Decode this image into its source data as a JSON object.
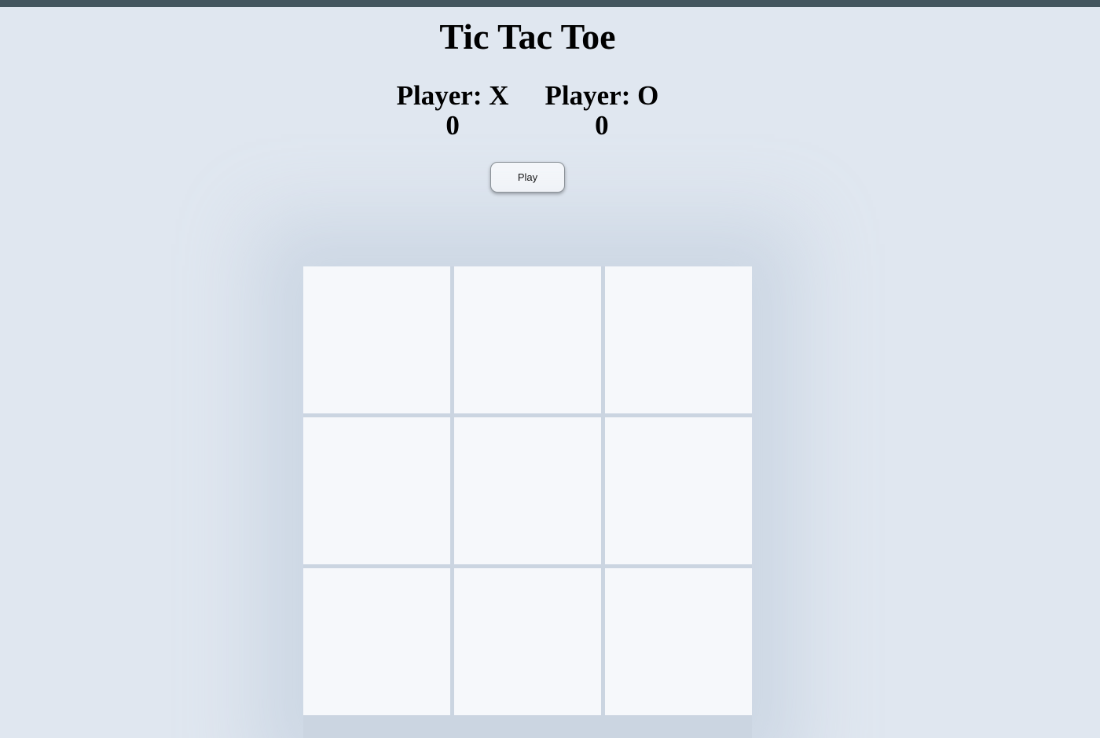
{
  "title": "Tic Tac Toe",
  "players": [
    {
      "label": "Player: X",
      "score": "0"
    },
    {
      "label": "Player: O",
      "score": "0"
    }
  ],
  "play_button": {
    "label": "Play"
  },
  "board": {
    "cells": [
      "",
      "",
      "",
      "",
      "",
      "",
      "",
      "",
      ""
    ]
  },
  "colors": {
    "page_background": "#e0e7f0",
    "top_bar": "#44565f",
    "cell_background": "#f6f8fb",
    "grid_lines": "#cbd5e1"
  }
}
